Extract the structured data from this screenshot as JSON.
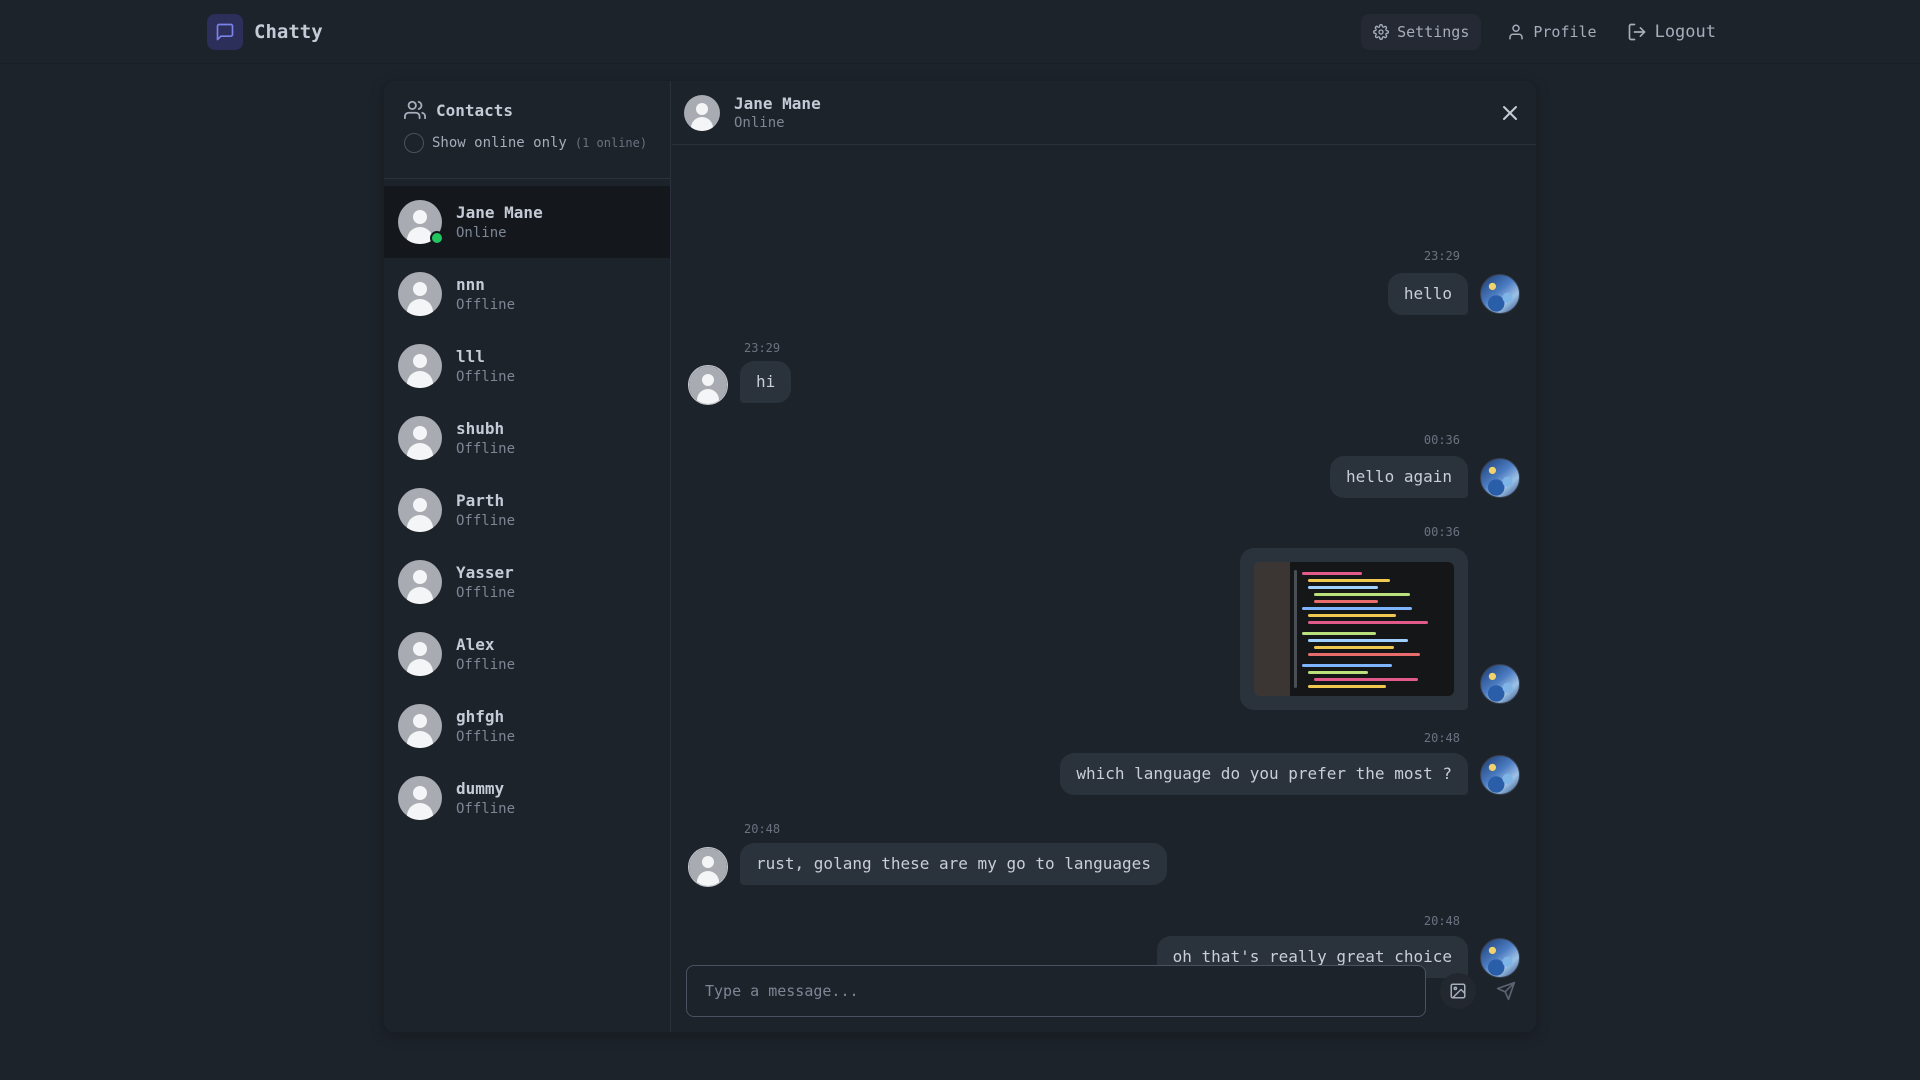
{
  "app": {
    "name": "Chatty"
  },
  "nav": {
    "settings": "Settings",
    "profile": "Profile",
    "logout": "Logout"
  },
  "sidebar": {
    "title": "Contacts",
    "filter_label": "Show online only",
    "online_count": "(1 online)",
    "contacts": [
      {
        "name": "Jane Mane",
        "status": "Online"
      },
      {
        "name": "nnn",
        "status": "Offline"
      },
      {
        "name": "lll",
        "status": "Offline"
      },
      {
        "name": "shubh",
        "status": "Offline"
      },
      {
        "name": "Parth",
        "status": "Offline"
      },
      {
        "name": "Yasser",
        "status": "Offline"
      },
      {
        "name": "Alex",
        "status": "Offline"
      },
      {
        "name": "ghfgh",
        "status": "Offline"
      },
      {
        "name": "dummy",
        "status": "Offline"
      }
    ]
  },
  "chat": {
    "name": "Jane Mane",
    "status": "Online",
    "messages": [
      {
        "time": "23:29",
        "text": "hello"
      },
      {
        "time": "23:29",
        "text": "hi"
      },
      {
        "time": "00:36",
        "text": "hello again"
      },
      {
        "time": "00:36",
        "text": ""
      },
      {
        "time": "20:48",
        "text": "which language do you prefer the most ?"
      },
      {
        "time": "20:48",
        "text": "rust, golang these are my go to languages"
      },
      {
        "time": "20:48",
        "text": "oh that's really great choice"
      }
    ],
    "input_placeholder": "Type a message..."
  },
  "colors": {
    "accent_online": "#22c55e",
    "bubble": "#2a323c",
    "background": "#1d232a"
  },
  "icons": {
    "brand": "chat-bubble-icon",
    "settings": "gear-icon",
    "profile": "user-icon",
    "logout": "logout-icon",
    "contacts": "users-icon",
    "close": "close-icon",
    "attach": "image-icon",
    "send": "send-icon"
  }
}
